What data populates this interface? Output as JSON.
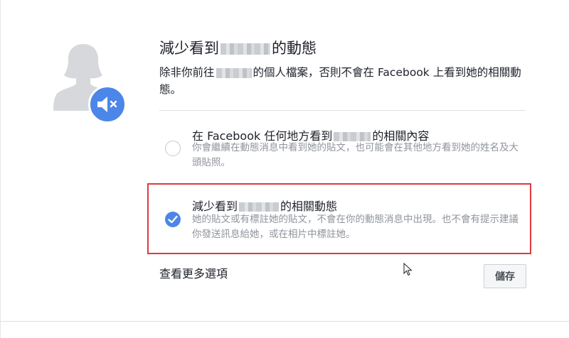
{
  "dialog": {
    "title_before": "減少看到",
    "title_after": "的動態",
    "desc_before": "除非你前往",
    "desc_after": "的個人檔案，否則不會在 Facebook 上看到她的相關動態。"
  },
  "options": [
    {
      "title_before": "在 Facebook 任何地方看到",
      "title_after": "的相關內容",
      "description": "你會繼續在動態消息中看到她的貼文，也可能會在其他地方看到她的姓名及大頭貼照。",
      "selected": false
    },
    {
      "title_before": "減少看到",
      "title_after": "的相關動態",
      "description": "她的貼文或有標註她的貼文，不會在你的動態消息中出現。也不會有提示建議你發送訊息給她，或在相片中標註她。",
      "selected": true
    }
  ],
  "footer": {
    "more_options_label": "查看更多選項",
    "save_label": "儲存"
  },
  "icons": {
    "avatar": "person-silhouette-icon",
    "mute": "speaker-mute-icon",
    "check": "checkmark-icon",
    "cursor": "mouse-pointer-icon"
  },
  "colors": {
    "accent_blue": "#4c86e8",
    "highlight_red": "#e0393e",
    "secondary_text": "#90949c"
  }
}
